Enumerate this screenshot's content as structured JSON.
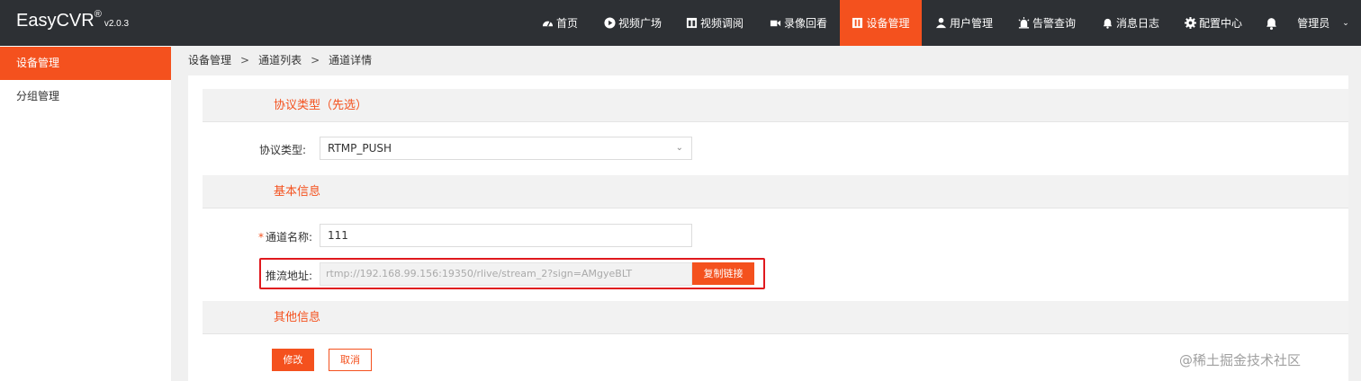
{
  "brand": {
    "name": "EasyCVR",
    "reg": "®",
    "version": "v2.0.3"
  },
  "nav": [
    {
      "label": "首页",
      "icon": "dashboard-icon"
    },
    {
      "label": "视频广场",
      "icon": "play-circle-icon"
    },
    {
      "label": "视频调阅",
      "icon": "grid-icon"
    },
    {
      "label": "录像回看",
      "icon": "video-camera-icon"
    },
    {
      "label": "设备管理",
      "icon": "device-icon",
      "active": true
    },
    {
      "label": "用户管理",
      "icon": "user-icon"
    },
    {
      "label": "告警查询",
      "icon": "alarm-icon"
    },
    {
      "label": "消息日志",
      "icon": "bell-icon"
    },
    {
      "label": "配置中心",
      "icon": "gear-icon"
    }
  ],
  "user": {
    "label": "管理员",
    "caret": "⌄"
  },
  "sidebar": {
    "items": [
      {
        "label": "设备管理",
        "active": true
      },
      {
        "label": "分组管理"
      }
    ]
  },
  "breadcrumb": [
    "设备管理",
    "通道列表",
    "通道详情"
  ],
  "breadcrumb_sep": ">",
  "form": {
    "protocol_section": "协议类型（先选）",
    "protocol_label": "协议类型:",
    "protocol_value": "RTMP_PUSH",
    "basic_section": "基本信息",
    "name_required": "*",
    "name_label": "通道名称:",
    "name_value": "111",
    "url_label": "推流地址:",
    "url_value": "rtmp://192.168.99.156:19350/rlive/stream_2?sign=AMgyeBLT",
    "copy_label": "复制链接",
    "other_section": "其他信息",
    "save_label": "修改",
    "cancel_label": "取消"
  },
  "watermark": "@稀土掘金技术社区",
  "colors": {
    "accent": "#f4511e",
    "topbar": "#2d3034",
    "highlight": "#e0191e"
  }
}
